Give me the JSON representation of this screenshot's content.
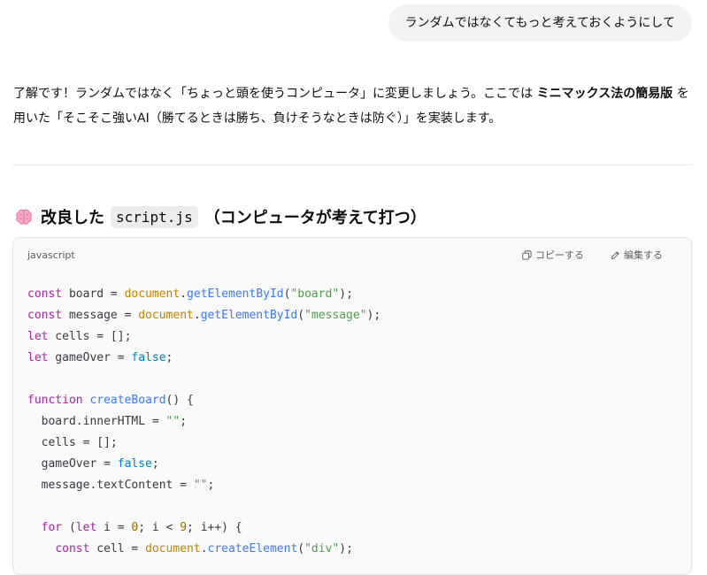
{
  "user_message": "ランダムではなくてもっと考えておくようにして",
  "answer": {
    "part1": "了解です！ランダムではなく「ちょっと頭を使うコンピュータ」に変更しましょう。ここでは ",
    "bold": "ミニマックス法の簡易版",
    "part2": " を用いた「そこそこ強いAI（勝てるときは勝ち、負けそうなときは防ぐ）」を実装します。"
  },
  "heading": {
    "icon": "brain-icon",
    "prefix": "改良した",
    "code": "script.js",
    "suffix": "（コンピュータが考えて打つ）"
  },
  "code_block": {
    "language": "javascript",
    "copy_label": "コピーする",
    "edit_label": "編集する",
    "lines": [
      [
        [
          "kw",
          "const"
        ],
        [
          "p",
          " board = "
        ],
        [
          "obj",
          "document"
        ],
        [
          "p",
          "."
        ],
        [
          "fn",
          "getElementById"
        ],
        [
          "p",
          "("
        ],
        [
          "str",
          "\"board\""
        ],
        [
          "p",
          ");"
        ]
      ],
      [
        [
          "kw",
          "const"
        ],
        [
          "p",
          " message = "
        ],
        [
          "obj",
          "document"
        ],
        [
          "p",
          "."
        ],
        [
          "fn",
          "getElementById"
        ],
        [
          "p",
          "("
        ],
        [
          "str",
          "\"message\""
        ],
        [
          "p",
          ");"
        ]
      ],
      [
        [
          "kw",
          "let"
        ],
        [
          "p",
          " cells = [];"
        ]
      ],
      [
        [
          "kw",
          "let"
        ],
        [
          "p",
          " gameOver = "
        ],
        [
          "lit",
          "false"
        ],
        [
          "p",
          ";"
        ]
      ],
      [],
      [
        [
          "kw",
          "function"
        ],
        [
          "p",
          " "
        ],
        [
          "fn",
          "createBoard"
        ],
        [
          "p",
          "() {"
        ]
      ],
      [
        [
          "p",
          "  board.innerHTML = "
        ],
        [
          "str",
          "\"\""
        ],
        [
          "p",
          ";"
        ]
      ],
      [
        [
          "p",
          "  cells = [];"
        ]
      ],
      [
        [
          "p",
          "  gameOver = "
        ],
        [
          "lit",
          "false"
        ],
        [
          "p",
          ";"
        ]
      ],
      [
        [
          "p",
          "  message.textContent = "
        ],
        [
          "str",
          "\"\""
        ],
        [
          "p",
          ";"
        ]
      ],
      [],
      [
        [
          "p",
          "  "
        ],
        [
          "kw",
          "for"
        ],
        [
          "p",
          " ("
        ],
        [
          "kw",
          "let"
        ],
        [
          "p",
          " i = "
        ],
        [
          "num",
          "0"
        ],
        [
          "p",
          "; i < "
        ],
        [
          "num",
          "9"
        ],
        [
          "p",
          "; i++) {"
        ]
      ],
      [
        [
          "p",
          "    "
        ],
        [
          "kw",
          "const"
        ],
        [
          "p",
          " cell = "
        ],
        [
          "obj",
          "document"
        ],
        [
          "p",
          "."
        ],
        [
          "fn",
          "createElement"
        ],
        [
          "p",
          "("
        ],
        [
          "str",
          "\"div\""
        ],
        [
          "p",
          ");"
        ]
      ]
    ]
  },
  "colors": {
    "keyword": "#a626a4",
    "function": "#4078f2",
    "string": "#50a14f",
    "number": "#986801",
    "literal": "#0184bc"
  }
}
